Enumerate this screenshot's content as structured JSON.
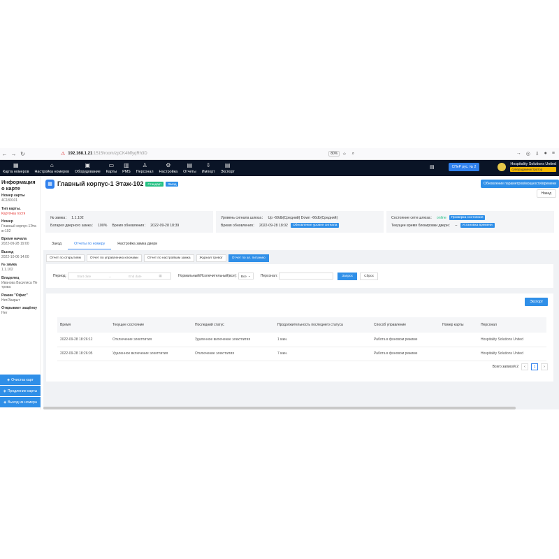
{
  "browser": {
    "url_host": "192.168.1.21",
    "url_path": ":1515/room/zpCK4MfyqRh3D",
    "zoom": "80%"
  },
  "menu": [
    {
      "label": "Карта номеров",
      "icon": "grid-icon",
      "glyph": "▦"
    },
    {
      "label": "Настройка номеров",
      "icon": "home-icon",
      "glyph": "⌂"
    },
    {
      "label": "Оборудование",
      "icon": "device-icon",
      "glyph": "▣"
    },
    {
      "label": "Карты",
      "icon": "card-icon",
      "glyph": "▭"
    },
    {
      "label": "PMS",
      "icon": "pms-icon",
      "glyph": "▥"
    },
    {
      "label": "Персонал",
      "icon": "person-icon",
      "glyph": "♙"
    },
    {
      "label": "Настройка",
      "icon": "gear-icon",
      "glyph": "⚙"
    },
    {
      "label": "Отчеты",
      "icon": "report-icon",
      "glyph": "▤"
    },
    {
      "label": "Импорт",
      "icon": "import-icon",
      "glyph": "⇩"
    },
    {
      "label": "Экспорт",
      "icon": "export-icon",
      "glyph": "▤"
    }
  ],
  "header": {
    "cpu_button": "СПеР рус. № 2",
    "user_name": "Hospitality Solutions United",
    "user_role": "суперадминистратор"
  },
  "sidebar": {
    "title": "Информация о карте",
    "fields": [
      {
        "label": "Номер карты",
        "value": "4C180101",
        "red": false
      },
      {
        "label": "Тип карты.",
        "value": "Карточка гостя",
        "red": true
      },
      {
        "label": "Номер",
        "value": "Главный корпус-1Эта ж-102",
        "red": false
      },
      {
        "label": "Время начала",
        "value": "2022-09-28 19:00",
        "red": false
      },
      {
        "label": "Выход",
        "value": "2022-10-06 14:00",
        "red": false
      },
      {
        "label": "№ замка",
        "value": "1.1.102",
        "red": false
      },
      {
        "label": "Владелец",
        "value": "Иванова Василиса Пе трова",
        "red": false
      },
      {
        "label": "Режим \"Офис\"",
        "value": "Нет/Закрыт",
        "red": false
      },
      {
        "label": "Открывает защёлку",
        "value": "Нет",
        "red": false
      }
    ],
    "actions": [
      "Очистка карт",
      "Продление карты",
      "Выход из номера"
    ]
  },
  "room": {
    "title": "Главный корпус-1 Этаж-102",
    "tag_status": "Стандарт",
    "tag_state": "Заезд",
    "update_button": "Обновление параметров/мощности/времени",
    "back_button": "Назад"
  },
  "info": {
    "lock_no_label": "№ замка：",
    "lock_no": "1.1.102",
    "battery_label": "Батарея дверного замка：",
    "battery": "100%",
    "update_time_label": "Время обновления：",
    "update_time": "2022-09-28 18:39",
    "signal_label": "Уровень сигнала шлюза：",
    "signal": "Up -69db(Средний) Down -66db(Средний)",
    "signal_update_label": "Время обновления：",
    "signal_update": "2022-09-28 18:02",
    "signal_button": "Обновление уровня сигнала",
    "gateway_label": "Состояние сети шлюза：",
    "gateway_status": "online",
    "gateway_button": "Проверка состояния",
    "block_label": "Текущее время блокировки двери：",
    "block_value": "--",
    "block_button": "Установка времени"
  },
  "tabs": [
    "Заезд",
    "Отчеты по номеру",
    "Настройка замка двери"
  ],
  "subtabs": [
    "Отчет по открытиям",
    "Отчет по управлению ключами",
    "Отчет по настройкам замка",
    "Журнал тревог",
    "Отчет по эл. питанию"
  ],
  "filter": {
    "period_label": "Период:",
    "start_placeholder": "Start date",
    "end_placeholder": "End date",
    "type_label": "Нормальный/Исключительный(все):",
    "type_value": "Все",
    "staff_label": "Персонал:",
    "query_button": "Запрос",
    "reset_button": "Сброс"
  },
  "table": {
    "export_button": "Экспорт",
    "columns": [
      "Время",
      "Текущее состояние",
      "Последний статус",
      "Продолжительность последнего статуса",
      "Способ управление",
      "Номер карты",
      "Персонал"
    ],
    "rows": [
      [
        "2022-09-28 18:26:12",
        "Отключение электпития",
        "Удаленное включение электпития",
        "1 мин.",
        "Работа в фоновом режиме",
        "",
        "Hospitality Solutions United"
      ],
      [
        "2022-09-28 18:26:05",
        "Удаленное включение электпития",
        "Отключение электпития",
        "7 мин.",
        "Работа в фоновом режиме",
        "",
        "Hospitality Solutions United"
      ]
    ],
    "total": "Всего записей 2",
    "current_page": "1"
  }
}
